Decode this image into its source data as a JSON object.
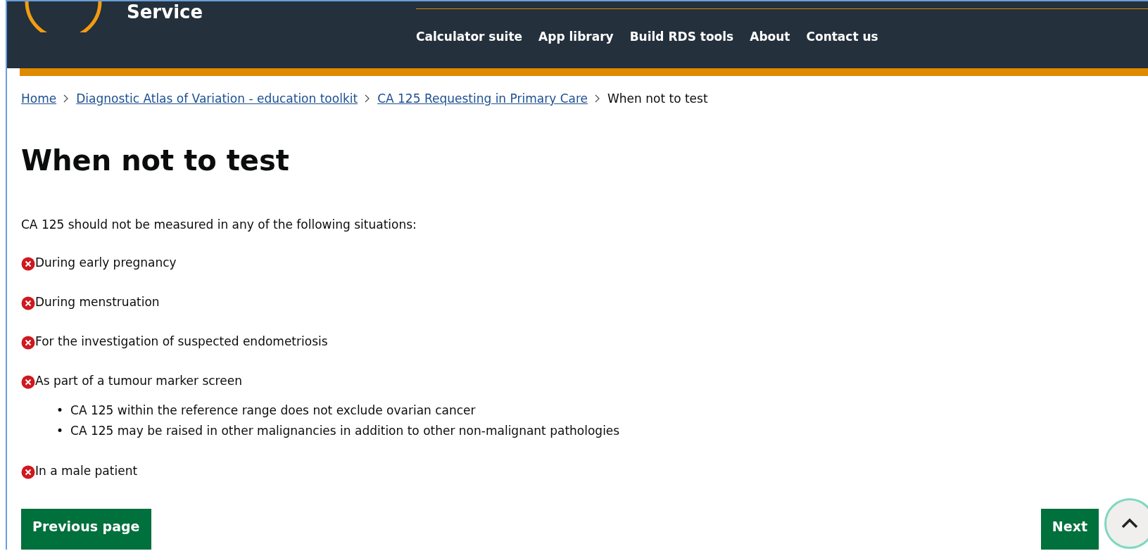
{
  "header": {
    "site_name": "Service",
    "nav": [
      "Calculator suite",
      "App library",
      "Build RDS tools",
      "About",
      "Contact us"
    ]
  },
  "breadcrumb": [
    {
      "label": "Home",
      "kind": "link"
    },
    {
      "label": "Diagnostic Atlas of Variation - education toolkit",
      "kind": "link"
    },
    {
      "label": "CA 125 Requesting in Primary Care",
      "kind": "link"
    },
    {
      "label": "When not to test",
      "kind": "current"
    }
  ],
  "title": "When not to test",
  "intro": "CA 125 should not be measured in any of the following situations:",
  "items": [
    {
      "text": "During early pregnancy"
    },
    {
      "text": "During menstruation"
    },
    {
      "text": "For the investigation of suspected endometriosis"
    },
    {
      "text": "As part of a tumour marker screen",
      "children": [
        {
          "marker": "•",
          "text": "CA 125 within the reference range does not exclude ovarian cancer"
        },
        {
          "marker": "•",
          "text": "CA 125 may be raised in other malignancies in addition to other non-malignant pathologies"
        }
      ]
    },
    {
      "text": "In a male patient"
    }
  ],
  "pager": {
    "previous": "Previous page",
    "next": "Next"
  }
}
